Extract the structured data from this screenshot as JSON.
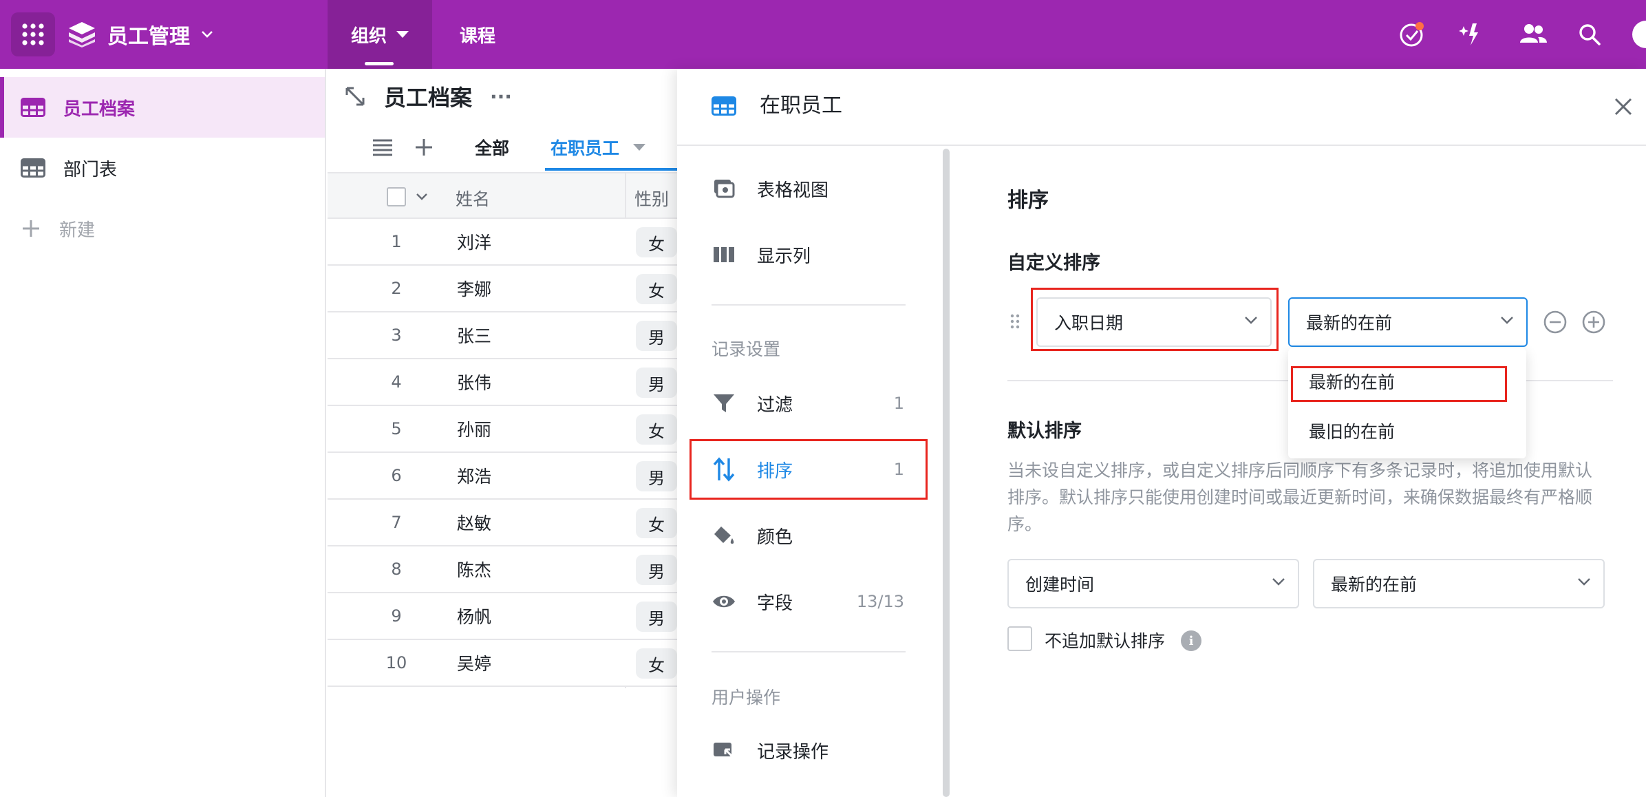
{
  "topbar": {
    "app_title": "员工管理",
    "nav": [
      {
        "label": "组织"
      },
      {
        "label": "课程"
      }
    ],
    "icons": [
      "apps-grid-icon",
      "app-logo-icon",
      "task-check-icon",
      "sparkle-icon",
      "members-icon",
      "search-icon",
      "avatar-icon"
    ],
    "colors": {
      "brand": "#9c27b0",
      "accent": "#1e88e5",
      "highlight": "#e8251e"
    }
  },
  "sidebar": {
    "items": [
      {
        "label": "员工档案"
      },
      {
        "label": "部门表"
      },
      {
        "label": "新建"
      }
    ]
  },
  "sheet": {
    "title": "员工档案",
    "more": "···",
    "tabs": [
      {
        "label": "全部"
      },
      {
        "label": "在职员工"
      }
    ],
    "columns": [
      "姓名",
      "性别"
    ],
    "rows": [
      {
        "idx": "1",
        "name": "刘洋",
        "gender": "女"
      },
      {
        "idx": "2",
        "name": "李娜",
        "gender": "女"
      },
      {
        "idx": "3",
        "name": "张三",
        "gender": "男"
      },
      {
        "idx": "4",
        "name": "张伟",
        "gender": "男"
      },
      {
        "idx": "5",
        "name": "孙丽",
        "gender": "女"
      },
      {
        "idx": "6",
        "name": "郑浩",
        "gender": "男"
      },
      {
        "idx": "7",
        "name": "赵敏",
        "gender": "女"
      },
      {
        "idx": "8",
        "name": "陈杰",
        "gender": "男"
      },
      {
        "idx": "9",
        "name": "杨帆",
        "gender": "男"
      },
      {
        "idx": "10",
        "name": "吴婷",
        "gender": "女"
      }
    ]
  },
  "panel": {
    "title": "在职员工",
    "nav": {
      "view_items": [
        {
          "label": "表格视图"
        },
        {
          "label": "显示列"
        }
      ],
      "record_group": "记录设置",
      "record_items": [
        {
          "label": "过滤",
          "count": "1"
        },
        {
          "label": "排序",
          "count": "1"
        },
        {
          "label": "颜色",
          "count": ""
        },
        {
          "label": "字段",
          "count": "13/13"
        }
      ],
      "user_group": "用户操作",
      "user_items": [
        {
          "label": "记录操作"
        }
      ]
    },
    "sort": {
      "heading": "排序",
      "custom_heading": "自定义排序",
      "custom_field": "入职日期",
      "custom_order": "最新的在前",
      "dropdown_options": [
        "最新的在前",
        "最旧的在前"
      ],
      "default_heading": "默认排序",
      "default_desc": "当未设自定义排序，或自定义排序后同顺序下有多条记录时，将追加使用默认排序。默认排序只能使用创建时间或最近更新时间，来确保数据最终有严格顺序。",
      "default_field": "创建时间",
      "default_order": "最新的在前",
      "no_default_label": "不追加默认排序",
      "info_glyph": "i"
    }
  }
}
